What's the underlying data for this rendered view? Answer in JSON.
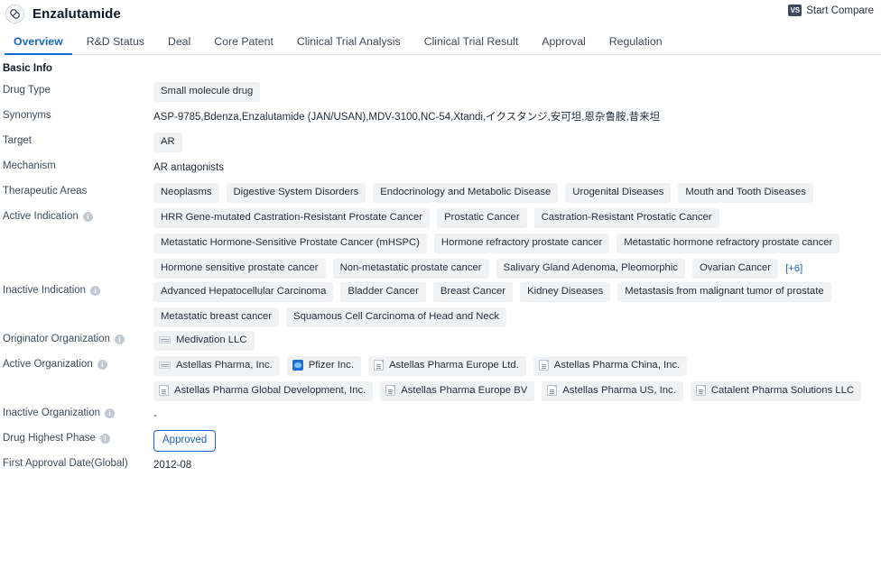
{
  "header": {
    "drug_icon": "capsule-icon",
    "title": "Enzalutamide",
    "compare_label": "Start Compare",
    "compare_badge": "VS"
  },
  "tabs": [
    {
      "label": "Overview",
      "active": true
    },
    {
      "label": "R&D Status",
      "active": false
    },
    {
      "label": "Deal",
      "active": false
    },
    {
      "label": "Core Patent",
      "active": false
    },
    {
      "label": "Clinical Trial Analysis",
      "active": false
    },
    {
      "label": "Clinical Trial Result",
      "active": false
    },
    {
      "label": "Approval",
      "active": false
    },
    {
      "label": "Regulation",
      "active": false
    }
  ],
  "section": {
    "basic_info_title": "Basic Info"
  },
  "rows": {
    "drug_type": {
      "label": "Drug Type",
      "tags": [
        "Small molecule drug"
      ]
    },
    "synonyms": {
      "label": "Synonyms",
      "value": "ASP-9785,Bdenza,Enzalutamide (JAN/USAN),MDV-3100,NC-54,Xtandi,イクスタンジ,安可坦,恩杂鲁胺,昔来坦"
    },
    "target": {
      "label": "Target",
      "tags": [
        "AR"
      ]
    },
    "mechanism": {
      "label": "Mechanism",
      "value": "AR antagonists"
    },
    "therapeutic_areas": {
      "label": "Therapeutic Areas",
      "tags": [
        "Neoplasms",
        "Digestive System Disorders",
        "Endocrinology and Metabolic Disease",
        "Urogenital Diseases",
        "Mouth and Tooth Diseases"
      ]
    },
    "active_indication": {
      "label": "Active Indication",
      "has_info": true,
      "tags": [
        "HRR Gene-mutated Castration-Resistant Prostate Cancer",
        "Prostatic Cancer",
        "Castration-Resistant Prostatic Cancer",
        "Metastatic Hormone-Sensitive Prostate Cancer (mHSPC)",
        "Hormone refractory prostate cancer",
        "Metastatic hormone refractory prostate cancer",
        "Hormone sensitive prostate cancer",
        "Non-metastatic prostate cancer",
        "Salivary Gland Adenoma, Pleomorphic",
        "Ovarian Cancer"
      ],
      "more": "[+6]"
    },
    "inactive_indication": {
      "label": "Inactive Indication",
      "has_info": true,
      "tags": [
        "Advanced Hepatocellular Carcinoma",
        "Bladder Cancer",
        "Breast Cancer",
        "Kidney Diseases",
        "Metastasis from malignant tumor of prostate",
        "Metastatic breast cancer",
        "Squamous Cell Carcinoma of Head and Neck"
      ]
    },
    "originator_organization": {
      "label": "Originator Organization",
      "has_info": true,
      "orgs": [
        {
          "name": "Medivation LLC",
          "icon": "medivation"
        }
      ]
    },
    "active_organization": {
      "label": "Active Organization",
      "has_info": true,
      "orgs": [
        {
          "name": "Astellas Pharma, Inc.",
          "icon": "medivation"
        },
        {
          "name": "Pfizer Inc.",
          "icon": "pfizer"
        },
        {
          "name": "Astellas Pharma Europe Ltd.",
          "icon": "astellas"
        },
        {
          "name": "Astellas Pharma China, Inc.",
          "icon": "astellas"
        },
        {
          "name": "Astellas Pharma Global Development, Inc.",
          "icon": "astellas"
        },
        {
          "name": "Astellas Pharma Europe BV",
          "icon": "astellas"
        },
        {
          "name": "Astellas Pharma US, Inc.",
          "icon": "astellas"
        },
        {
          "name": "Catalent Pharma Solutions LLC",
          "icon": "astellas"
        }
      ]
    },
    "inactive_organization": {
      "label": "Inactive Organization",
      "has_info": true,
      "value": "-"
    },
    "drug_highest_phase": {
      "label": "Drug Highest Phase",
      "has_info": true,
      "badge": "Approved"
    },
    "first_approval_date": {
      "label": "First Approval Date(Global)",
      "value": "2012-08"
    }
  },
  "colors": {
    "accent": "#1864c8",
    "tag_bg": "#f1f2f4",
    "approved_border": "#1a5fc4",
    "vs_badge_bg": "#3c4a63"
  }
}
